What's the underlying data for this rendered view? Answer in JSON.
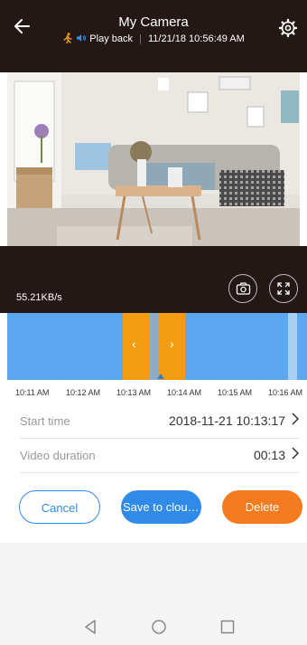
{
  "header": {
    "title": "My Camera",
    "mode_label": "Play back",
    "timestamp": "11/21/18 10:56:49 AM"
  },
  "video": {
    "speed": "55.21KB/s"
  },
  "timeline": {
    "ticks": [
      "10:11 AM",
      "10:12 AM",
      "10:13 AM",
      "10:14 AM",
      "10:15 AM",
      "10:16 AM"
    ],
    "prev_glyph": "‹",
    "next_glyph": "›"
  },
  "fields": {
    "start_time_label": "Start time",
    "start_time_value": "2018-11-21 10:13:17",
    "duration_label": "Video duration",
    "duration_value": "00:13"
  },
  "actions": {
    "cancel": "Cancel",
    "save": "Save to cloud...",
    "delete": "Delete"
  },
  "colors": {
    "accent_blue": "#2f8ae8",
    "accent_orange": "#f47b20",
    "header_bg": "#231815"
  }
}
